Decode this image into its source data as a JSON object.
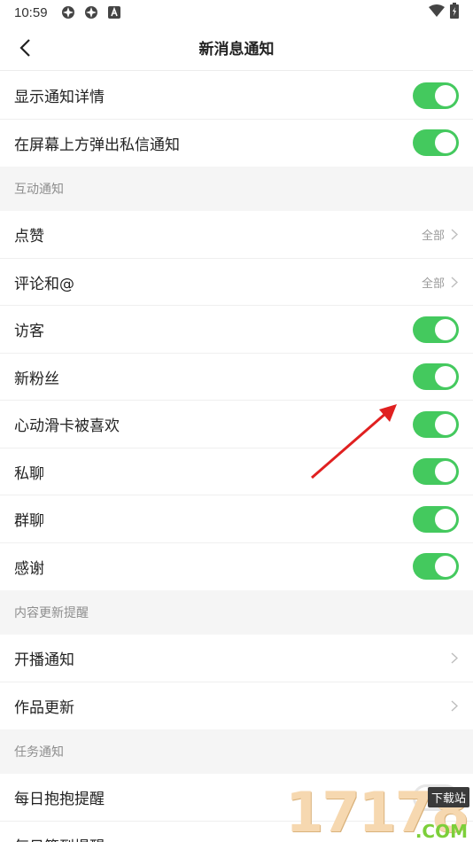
{
  "status_bar": {
    "time": "10:59"
  },
  "nav": {
    "title": "新消息通知"
  },
  "top_rows": [
    {
      "label": "显示通知详情",
      "toggle_on": true
    },
    {
      "label": "在屏幕上方弹出私信通知",
      "toggle_on": true
    }
  ],
  "sections": [
    {
      "title": "互动通知",
      "rows": [
        {
          "label": "点赞",
          "value": "全部"
        },
        {
          "label": "评论和@",
          "value": "全部"
        },
        {
          "label": "访客",
          "toggle_on": true
        },
        {
          "label": "新粉丝",
          "toggle_on": true
        },
        {
          "label": "心动滑卡被喜欢",
          "toggle_on": true
        },
        {
          "label": "私聊",
          "toggle_on": true
        },
        {
          "label": "群聊",
          "toggle_on": true
        },
        {
          "label": "感谢",
          "toggle_on": true
        }
      ]
    },
    {
      "title": "内容更新提醒",
      "rows": [
        {
          "label": "开播通知"
        },
        {
          "label": "作品更新"
        }
      ]
    },
    {
      "title": "任务通知",
      "rows": [
        {
          "label": "每日抱抱提醒",
          "toggle_on": false
        },
        {
          "label": "每日签到提醒"
        }
      ]
    }
  ],
  "watermark": {
    "digits": "17178",
    "badge": "下载站",
    "suffix": ".COM"
  },
  "colors": {
    "toggle_on": "#44c95e",
    "section_bg": "#f5f5f5",
    "annotation_arrow": "#e02020"
  }
}
